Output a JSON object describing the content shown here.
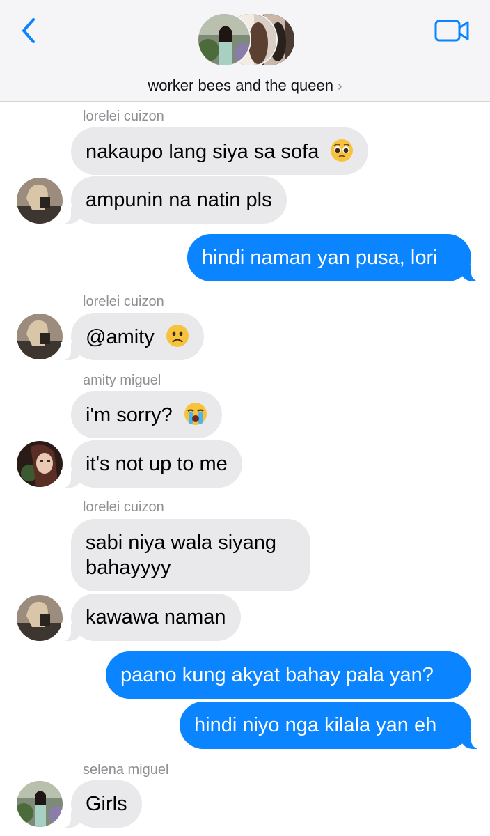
{
  "header": {
    "group_name": "worker bees and the queen",
    "chevron": "›",
    "back_icon": "chevron-left-icon",
    "video_icon": "video-camera-icon"
  },
  "colors": {
    "accent": "#0a84ff",
    "incoming": "#e9e9eb",
    "sender_gray": "#8e8e93"
  },
  "messages": {
    "m1": {
      "sender": "lorelei cuizon",
      "text": "nakaupo lang siya sa sofa",
      "emoji": "pleading-face"
    },
    "m2": {
      "text": "ampunin na natin pls"
    },
    "m3": {
      "text": "hindi naman yan pusa, lori"
    },
    "m4": {
      "sender": "lorelei cuizon",
      "text": "@amity",
      "emoji": "frowning-face"
    },
    "m5": {
      "sender": "amity miguel",
      "text": "i'm sorry?",
      "emoji": "loudly-crying-face"
    },
    "m6": {
      "text": "it's not up to me"
    },
    "m7": {
      "sender": "lorelei cuizon",
      "line1": "sabi niya wala siyang",
      "line2": "bahayyyy"
    },
    "m8": {
      "text": "kawawa naman"
    },
    "m9": {
      "text": "paano kung akyat bahay pala yan?"
    },
    "m10": {
      "text": "hindi niyo nga kilala yan eh"
    },
    "m11": {
      "sender": "selena miguel",
      "text": "Girls"
    }
  }
}
